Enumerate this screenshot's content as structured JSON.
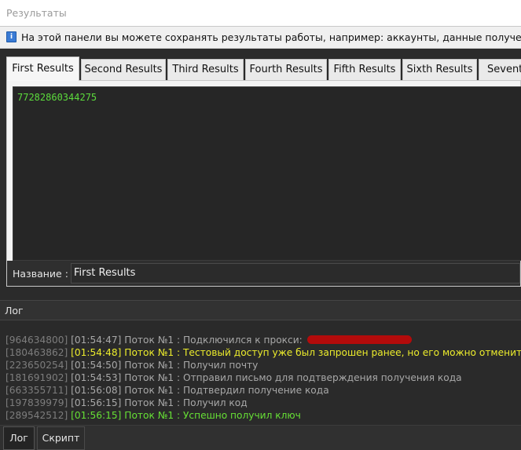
{
  "window": {
    "title": "Результаты"
  },
  "info": {
    "icon": "info-icon",
    "text": "На этой панели вы можете сохранять результаты работы, например: аккаунты, данные полученные из стр"
  },
  "tabs": [
    {
      "label": "First Results",
      "active": true
    },
    {
      "label": "Second Results"
    },
    {
      "label": "Third Results"
    },
    {
      "label": "Fourth Results"
    },
    {
      "label": "Fifth Results"
    },
    {
      "label": "Sixth Results"
    },
    {
      "label": "Seventh"
    }
  ],
  "results": {
    "value": "77282860344275"
  },
  "name_field": {
    "label": "Название :",
    "value": "First Results"
  },
  "log": {
    "header": "Лог",
    "lines": [
      {
        "id": "[964634800]",
        "msg": "[01:54:47] Поток №1 : Подключился к прокси:",
        "level": "info",
        "redacted": true
      },
      {
        "id": "[180463862]",
        "msg": "[01:54:48] Поток №1 : Тестовый доступ уже был запрошен ранее, но его можно отменить.",
        "level": "warn"
      },
      {
        "id": "[223650254]",
        "msg": "[01:54:50] Поток №1 : Получил почту",
        "level": "info"
      },
      {
        "id": "[181691902]",
        "msg": "[01:54:53] Поток №1 : Отправил письмо для подтверждения получения кода",
        "level": "info"
      },
      {
        "id": "[663355711]",
        "msg": "[01:56:08] Поток №1 : Подтвердил получение кода",
        "level": "info"
      },
      {
        "id": "[197839979]",
        "msg": "[01:56:15] Поток №1 : Получил код",
        "level": "info"
      },
      {
        "id": "[289542512]",
        "msg": "[01:56:15] Поток №1 : Успешно получил ключ",
        "level": "ok"
      }
    ]
  },
  "bottom_tabs": [
    {
      "label": "Лог",
      "active": true
    },
    {
      "label": "Скрипт"
    }
  ]
}
